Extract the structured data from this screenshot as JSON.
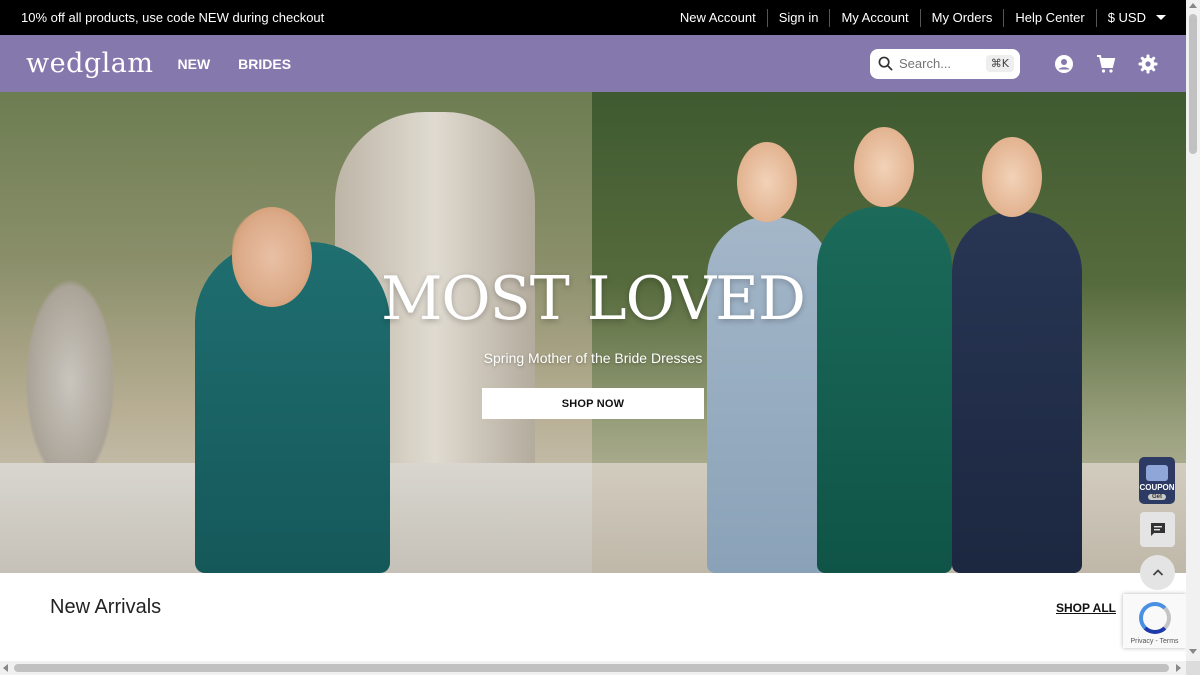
{
  "promo": {
    "text": "10% off all products, use code NEW during checkout"
  },
  "top_links": {
    "new_account": "New Account",
    "sign_in": "Sign in",
    "my_account": "My Account",
    "my_orders": "My Orders",
    "help_center": "Help Center",
    "currency": "$ USD"
  },
  "nav": {
    "logo": "wedglam",
    "links": {
      "new": "NEW",
      "brides": "BRIDES"
    },
    "search_placeholder": "Search...",
    "shortcut": "⌘K"
  },
  "hero": {
    "title": "MOST LOVED",
    "subtitle": "Spring Mother of the Bride Dresses",
    "cta": "SHOP NOW"
  },
  "widgets": {
    "coupon_label": "COUPON",
    "coupon_tag": "Get"
  },
  "section": {
    "title": "New Arrivals",
    "shop_all": "SHOP ALL"
  },
  "recaptcha": {
    "text": "Privacy - Terms"
  },
  "colors": {
    "topbar_bg": "#000000",
    "nav_bg": "#8578ad",
    "coupon_bg": "#2d3b64"
  }
}
